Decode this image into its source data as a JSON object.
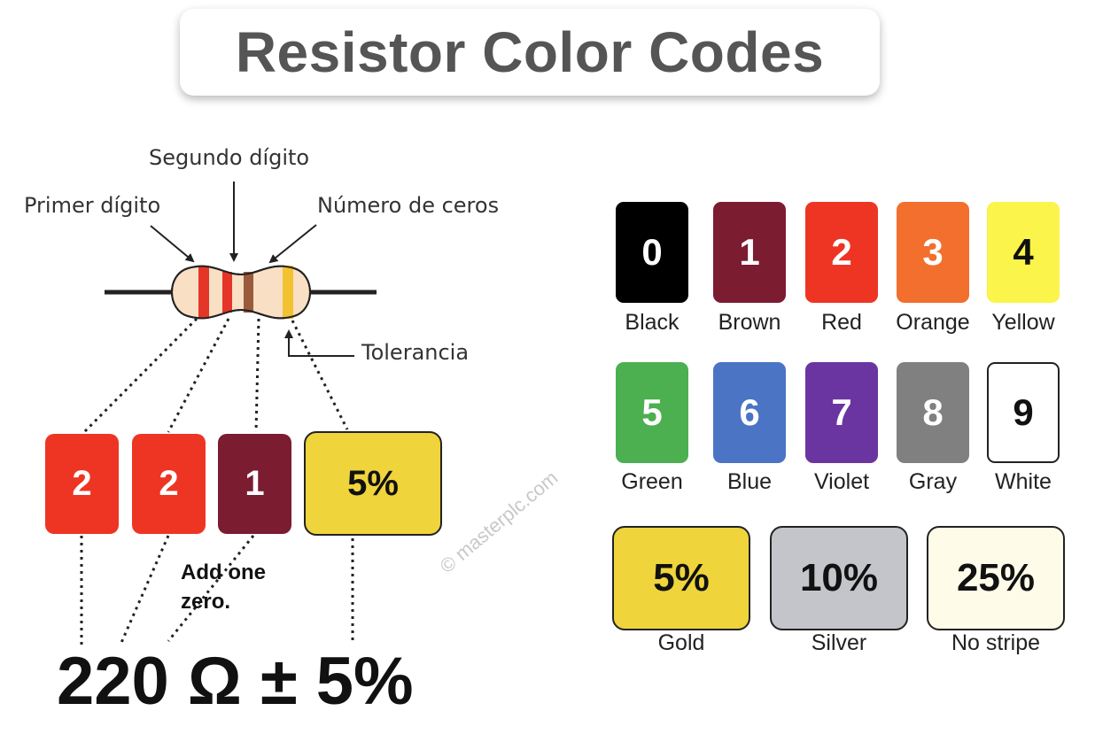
{
  "title": "Resistor Color Codes",
  "labels": {
    "first_digit": "Primer dígito",
    "second_digit": "Segundo dígito",
    "multiplier": "Número de ceros",
    "tolerance": "Tolerancia"
  },
  "example": {
    "bands": [
      {
        "value": "2",
        "color": "#ee3524"
      },
      {
        "value": "2",
        "color": "#ee3524"
      },
      {
        "value": "1",
        "color": "#7b1c31"
      },
      {
        "value": "5%",
        "color": "#efd43c"
      }
    ],
    "annotation_line1": "Add one",
    "annotation_line2": "zero.",
    "result": "220 Ω ± 5%"
  },
  "color_codes": [
    {
      "digit": "0",
      "name": "Black",
      "color": "#000000",
      "text_color": "#ffffff"
    },
    {
      "digit": "1",
      "name": "Brown",
      "color": "#7b1c31",
      "text_color": "#ffffff"
    },
    {
      "digit": "2",
      "name": "Red",
      "color": "#ee3524",
      "text_color": "#ffffff"
    },
    {
      "digit": "3",
      "name": "Orange",
      "color": "#f26f2d",
      "text_color": "#ffffff"
    },
    {
      "digit": "4",
      "name": "Yellow",
      "color": "#fbf44a",
      "text_color": "#111111"
    },
    {
      "digit": "5",
      "name": "Green",
      "color": "#4caf50",
      "text_color": "#ffffff"
    },
    {
      "digit": "6",
      "name": "Blue",
      "color": "#4b74c4",
      "text_color": "#ffffff"
    },
    {
      "digit": "7",
      "name": "Violet",
      "color": "#6a35a0",
      "text_color": "#ffffff"
    },
    {
      "digit": "8",
      "name": "Gray",
      "color": "#808080",
      "text_color": "#ffffff"
    },
    {
      "digit": "9",
      "name": "White",
      "color": "#ffffff",
      "text_color": "#111111"
    }
  ],
  "tolerances": [
    {
      "value": "5%",
      "name": "Gold",
      "color": "#efd43c"
    },
    {
      "value": "10%",
      "name": "Silver",
      "color": "#c3c5cb"
    },
    {
      "value": "25%",
      "name": "No stripe",
      "color": "#fefce8"
    }
  ],
  "watermark": "© masterplc.com"
}
